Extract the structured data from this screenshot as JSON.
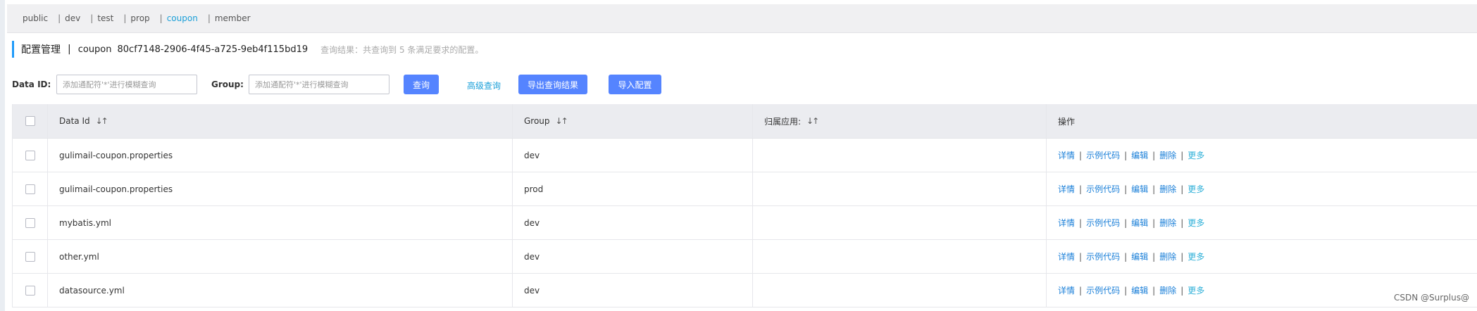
{
  "namespaces": [
    {
      "label": "public",
      "separator": "|"
    },
    {
      "label": "dev",
      "separator": "|"
    },
    {
      "label": "test",
      "separator": "|"
    },
    {
      "label": "prop",
      "separator": "|"
    },
    {
      "label": "coupon",
      "separator": "|",
      "active": true
    },
    {
      "label": "member",
      "separator": "|"
    }
  ],
  "title": {
    "main": "配置管理",
    "separator": "|",
    "namespace": "coupon",
    "namespace_id": "80cf7148-2906-4f45-a725-9eb4f115bd19",
    "hint": "查询结果：共查询到 5 条满足要求的配置。"
  },
  "query": {
    "data_id_label": "Data ID:",
    "data_id_placeholder": "添加通配符'*'进行模糊查询",
    "group_label": "Group:",
    "group_placeholder": "添加通配符'*'进行模糊查询",
    "search_button": "查询",
    "advanced_link": "高级查询",
    "export_button": "导出查询结果",
    "import_button": "导入配置"
  },
  "table": {
    "headers": {
      "data_id": "Data Id",
      "group": "Group",
      "app": "归属应用:",
      "ops": "操作"
    },
    "sort_icon": "sort-icon",
    "rows": [
      {
        "data_id": "gulimail-coupon.properties",
        "group": "dev",
        "app": ""
      },
      {
        "data_id": "gulimail-coupon.properties",
        "group": "prod",
        "app": ""
      },
      {
        "data_id": "mybatis.yml",
        "group": "dev",
        "app": ""
      },
      {
        "data_id": "other.yml",
        "group": "dev",
        "app": ""
      },
      {
        "data_id": "datasource.yml",
        "group": "dev",
        "app": ""
      }
    ],
    "actions": {
      "detail": "详情",
      "sample": "示例代码",
      "edit": "编辑",
      "delete": "删除",
      "more": "更多",
      "separator": "|"
    }
  },
  "watermark": "CSDN @Surplus@",
  "colors": {
    "primary_button": "#5584ff",
    "link": "#1a7fd8",
    "active_namespace": "#1a9fd8",
    "header_bg": "#ebecf0"
  }
}
